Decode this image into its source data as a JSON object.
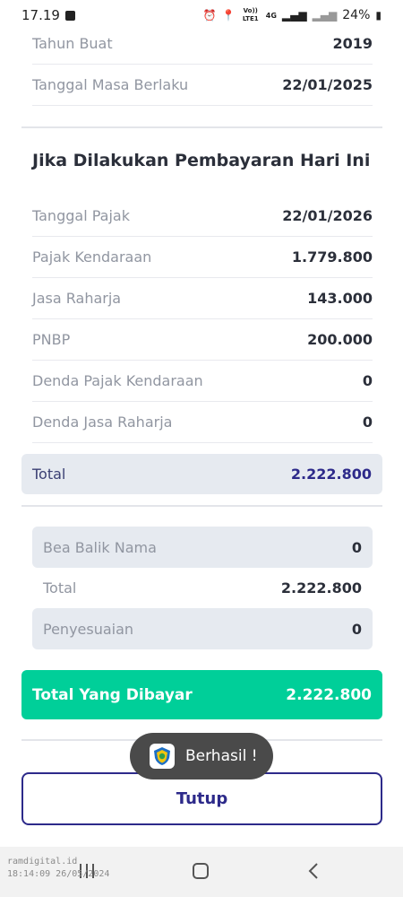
{
  "status_bar": {
    "time": "17.19",
    "network": "Vo)) LTE1",
    "network_type": "4G",
    "battery": "24%",
    "icons": [
      "notification-check-icon",
      "alarm-icon",
      "location-icon",
      "signal-icon",
      "battery-icon"
    ]
  },
  "vehicle_info": [
    {
      "label": "Tahun Buat",
      "value": "2019"
    },
    {
      "label": "Tanggal Masa Berlaku",
      "value": "22/01/2025"
    }
  ],
  "payment_section": {
    "title": "Jika Dilakukan Pembayaran Hari Ini",
    "items": [
      {
        "label": "Tanggal Pajak",
        "value": "22/01/2026"
      },
      {
        "label": "Pajak Kendaraan",
        "value": "1.779.800"
      },
      {
        "label": "Jasa Raharja",
        "value": "143.000"
      },
      {
        "label": "PNBP",
        "value": "200.000"
      },
      {
        "label": "Denda Pajak Kendaraan",
        "value": "0"
      },
      {
        "label": "Denda Jasa Raharja",
        "value": "0"
      }
    ],
    "total": {
      "label": "Total",
      "value": "2.222.800"
    }
  },
  "adjustments": {
    "bea_balik_nama": {
      "label": "Bea Balik Nama",
      "value": "0"
    },
    "total": {
      "label": "Total",
      "value": "2.222.800"
    },
    "penyesuaian": {
      "label": "Penyesuaian",
      "value": "0"
    }
  },
  "grand_total": {
    "label": "Total Yang Dibayar",
    "value": "2.222.800"
  },
  "toast": {
    "text": "Berhasil !"
  },
  "close_button": {
    "label": "Tutup"
  },
  "watermark": {
    "line1": "ramdigital.id",
    "line2": "18:14:09 26/05/2024"
  },
  "colors": {
    "accent": "#00cf99",
    "primary": "#2d2a8a",
    "panel": "#e6eaf0"
  }
}
